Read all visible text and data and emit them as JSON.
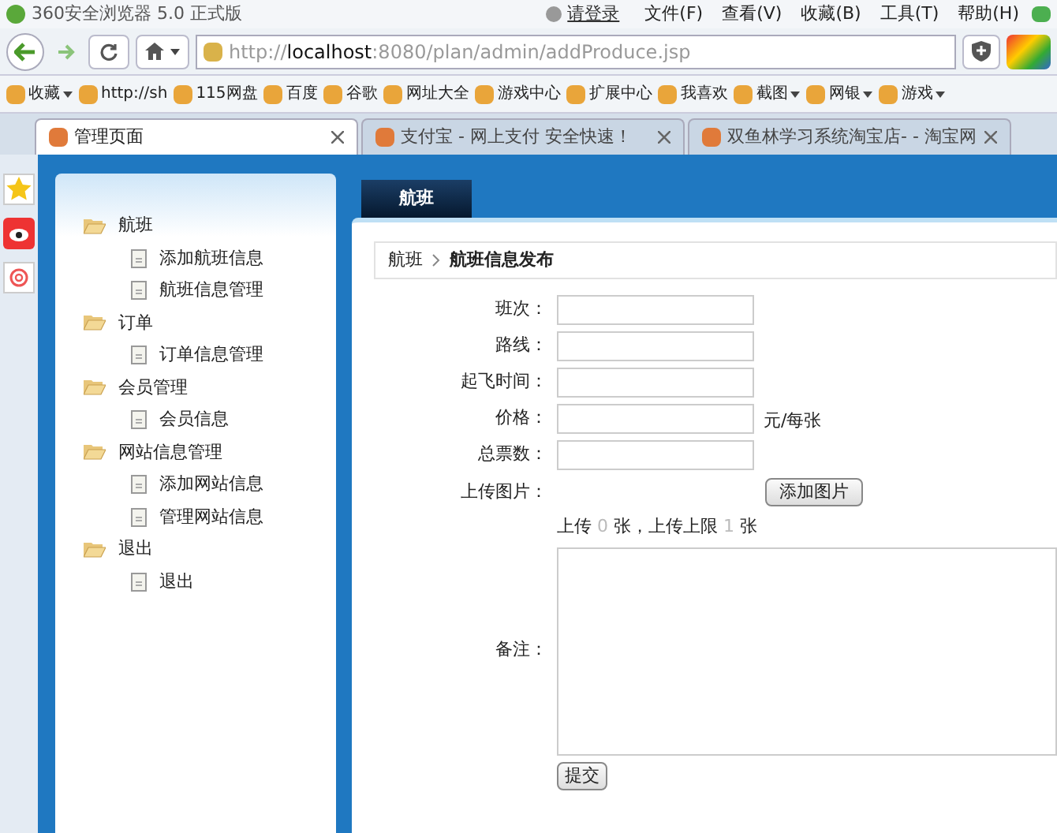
{
  "browser": {
    "title": "360安全浏览器 5.0 正式版",
    "login": "请登录",
    "menu": [
      "文件(F)",
      "查看(V)",
      "收藏(B)",
      "工具(T)",
      "帮助(H)"
    ],
    "address": {
      "scheme": "http://",
      "host": "localhost",
      "rest": ":8080/plan/admin/addProduce.jsp"
    },
    "bookmarks": [
      {
        "label": "收藏",
        "dropdown": true
      },
      {
        "label": "http://sh",
        "dropdown": false
      },
      {
        "label": "115网盘",
        "dropdown": false
      },
      {
        "label": "百度",
        "dropdown": false
      },
      {
        "label": "谷歌",
        "dropdown": false
      },
      {
        "label": "网址大全",
        "dropdown": false
      },
      {
        "label": "游戏中心",
        "dropdown": false
      },
      {
        "label": "扩展中心",
        "dropdown": false
      },
      {
        "label": "我喜欢",
        "dropdown": false
      },
      {
        "label": "截图",
        "dropdown": true
      },
      {
        "label": "网银",
        "dropdown": true
      },
      {
        "label": "游戏",
        "dropdown": true
      }
    ],
    "tabs": [
      {
        "label": "管理页面",
        "selected": true
      },
      {
        "label": "支付宝 - 网上支付 安全快速！",
        "selected": false
      },
      {
        "label": "双鱼林学习系统淘宝店- - 淘宝网",
        "selected": false
      }
    ]
  },
  "sidebar": {
    "groups": [
      {
        "label": "航班",
        "children": [
          {
            "label": "添加航班信息"
          },
          {
            "label": "航班信息管理"
          }
        ]
      },
      {
        "label": "订单",
        "children": [
          {
            "label": "订单信息管理"
          }
        ]
      },
      {
        "label": "会员管理",
        "children": [
          {
            "label": "会员信息"
          }
        ]
      },
      {
        "label": "网站信息管理",
        "children": [
          {
            "label": "添加网站信息"
          },
          {
            "label": "管理网站信息"
          }
        ]
      },
      {
        "label": "退出",
        "children": [
          {
            "label": "退出"
          }
        ]
      }
    ]
  },
  "main": {
    "tab": "航班",
    "breadcrumb": {
      "parent": "航班",
      "current": "航班信息发布"
    },
    "fields": [
      {
        "kind": "text",
        "label": "班次："
      },
      {
        "kind": "text",
        "label": "路线："
      },
      {
        "kind": "text",
        "label": "起飞时间："
      },
      {
        "kind": "text",
        "label": "价格：",
        "suffix": "元/每张"
      },
      {
        "kind": "text",
        "label": "总票数："
      },
      {
        "kind": "upload",
        "label": "上传图片：",
        "button": "添加图片"
      },
      {
        "kind": "status",
        "prefix": "上传",
        "count": "0",
        "middle": "张，上传上限",
        "limit": "1",
        "suffix": "张"
      },
      {
        "kind": "textarea",
        "label": "备注："
      }
    ],
    "submit": "提交"
  }
}
